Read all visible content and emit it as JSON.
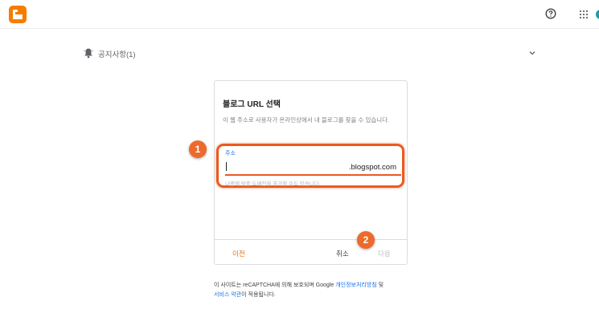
{
  "header": {
    "logo_icon": "blogger-logo-icon",
    "help_icon": "help-circle-icon",
    "apps_icon": "apps-grid-icon"
  },
  "notice": {
    "icon": "bell-icon",
    "text": "공지사항(1)",
    "expand_icon": "chevron-down-icon"
  },
  "card": {
    "title": "블로그 URL 선택",
    "description": "이 웹 주소로 사용자가 온라인상에서 내 블로그를 찾을 수 있습니다.",
    "field": {
      "label": "주소",
      "value": "",
      "suffix": ".blogspot.com",
      "helper": "나중에 맞춤 도메인을 추가할 수도 있습니다."
    },
    "buttons": {
      "prev": "이전",
      "cancel": "취소",
      "next": "다음"
    }
  },
  "annotations": {
    "badge1": "1",
    "badge2": "2"
  },
  "footer": {
    "prefix": "이 사이트는 reCAPTCHA에 의해 보호되며 Google ",
    "privacy_link": "개인정보처리방침",
    "and": " 및",
    "terms_link": "서비스 약관",
    "suffix": "이 적용됩니다."
  },
  "colors": {
    "brand": "#f57d00",
    "accent": "#ea5a1f",
    "link": "#1a73e8"
  }
}
